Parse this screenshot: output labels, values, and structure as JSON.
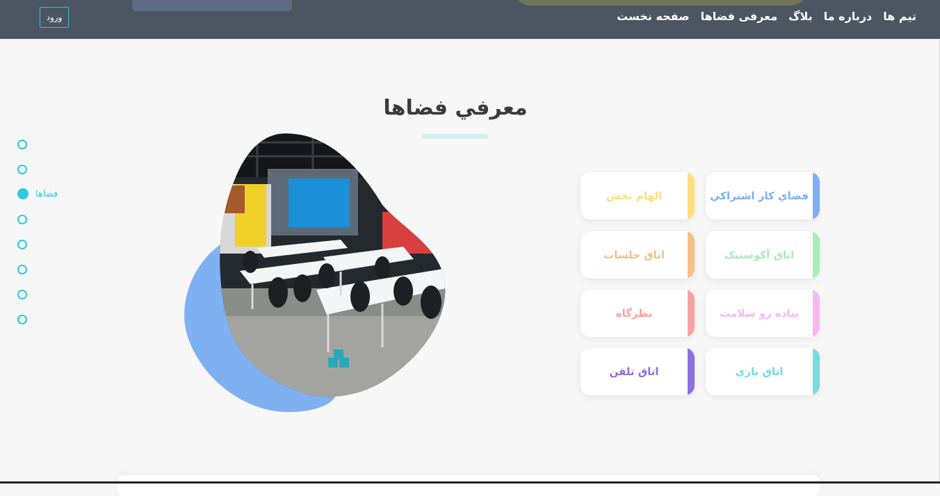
{
  "header": {
    "nav": [
      {
        "label": "صفحه نخست"
      },
      {
        "label": "معرفی فضاها"
      },
      {
        "label": "بلاگ"
      },
      {
        "label": "درباره ما"
      },
      {
        "label": "تیم ها"
      }
    ],
    "login_label": "ورود"
  },
  "section": {
    "title": "معرفي فضاها"
  },
  "dots_nav": {
    "active_label": "فضاها",
    "count": 8,
    "active_index": 2
  },
  "cards": [
    {
      "label": "فضاي كار اشتراكي",
      "color": "#7eaef4"
    },
    {
      "label": "الهام بخش",
      "color": "#fbe07b"
    },
    {
      "label": "اتاق آكوستيک",
      "color": "#a8eeb7"
    },
    {
      "label": "اتاق جلسات",
      "color": "#f2c08a"
    },
    {
      "label": "پياده رو سلامت",
      "color": "#f7b7ef"
    },
    {
      "label": "نظرگاه",
      "color": "#f6a2a2"
    },
    {
      "label": "اتاق بازي",
      "color": "#77dbe2"
    },
    {
      "label": "اتاق تلفن",
      "color": "#8c6fe0"
    }
  ],
  "colors": {
    "header_bg": "#4c5562",
    "accent": "#2ec8e2",
    "blob": "#7fb0f2"
  }
}
